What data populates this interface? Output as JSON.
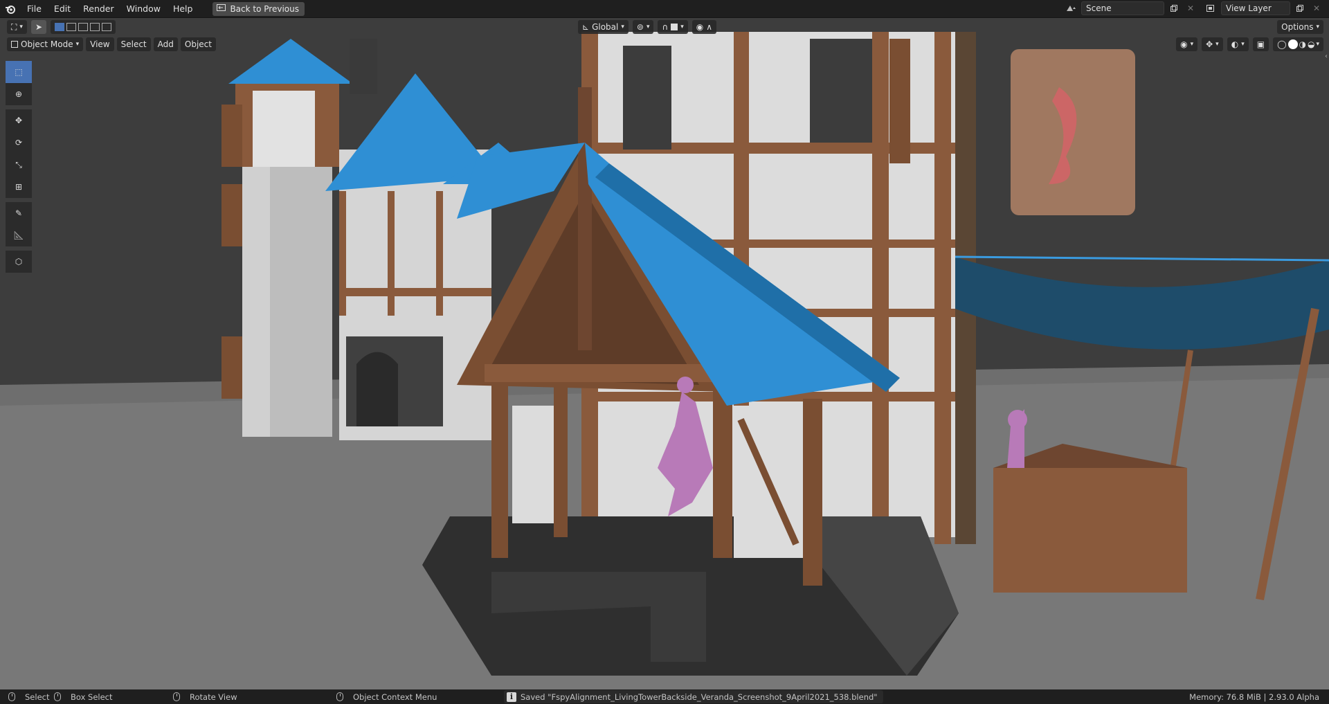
{
  "topbar": {
    "menus": [
      "File",
      "Edit",
      "Render",
      "Window",
      "Help"
    ],
    "back_label": "Back to Previous",
    "scene_name": "Scene",
    "view_layer_name": "View Layer"
  },
  "viewport_header": {
    "mode": "Object Mode",
    "menus": [
      "View",
      "Select",
      "Add",
      "Object"
    ],
    "transform_orientation": "Global",
    "options_label": "Options"
  },
  "tools": [
    {
      "icon": "select-box-icon",
      "active": true
    },
    {
      "icon": "cursor-icon",
      "active": false
    },
    {
      "icon": "move-icon",
      "active": false
    },
    {
      "icon": "rotate-icon",
      "active": false
    },
    {
      "icon": "scale-icon",
      "active": false
    },
    {
      "icon": "transform-icon",
      "active": false
    },
    {
      "icon": "annotate-icon",
      "active": false
    },
    {
      "icon": "measure-icon",
      "active": false
    },
    {
      "icon": "add-cube-icon",
      "active": false
    }
  ],
  "statusbar": {
    "select": "Select",
    "box_select": "Box Select",
    "rotate_view": "Rotate View",
    "context_menu": "Object Context Menu",
    "saved_message": "Saved \"FspyAlignment_LivingTowerBackside_Veranda_Screenshot_9April2021_538.blend\"",
    "memory": "Memory: 76.8 MiB | 2.93.0 Alpha"
  },
  "colors": {
    "accent": "#4772b3",
    "roof": "#2f8fd4",
    "wood": "#8a5a3c",
    "plaster": "#d8d8d8",
    "figure": "#b87ab8"
  }
}
